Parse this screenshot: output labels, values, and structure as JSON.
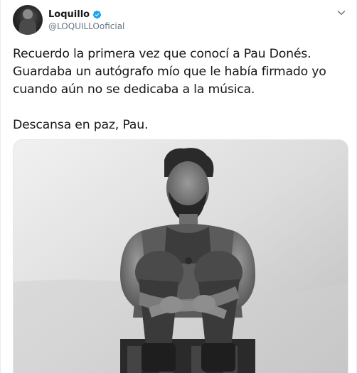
{
  "author": {
    "display_name": "Loquillo",
    "handle": "@LOQUILLOoficial",
    "verified": true
  },
  "tweet": {
    "lines_paragraph_1": [
      "Recuerdo la primera vez que conocí a Pau Donés.",
      "Guardaba un autógrafo mío que le había firmado yo",
      "cuando aún no se dedicaba a la música."
    ],
    "line_paragraph_2": "Descansa en paz, Pau."
  },
  "media": {
    "type": "photo",
    "style": "black-and-white"
  },
  "icons": {
    "verified": "verified-badge-icon",
    "more": "chevron-down-icon"
  },
  "colors": {
    "verified_blue": "#1da1f2",
    "text": "#14171a",
    "secondary": "#657786",
    "border": "#e6ecf0"
  }
}
